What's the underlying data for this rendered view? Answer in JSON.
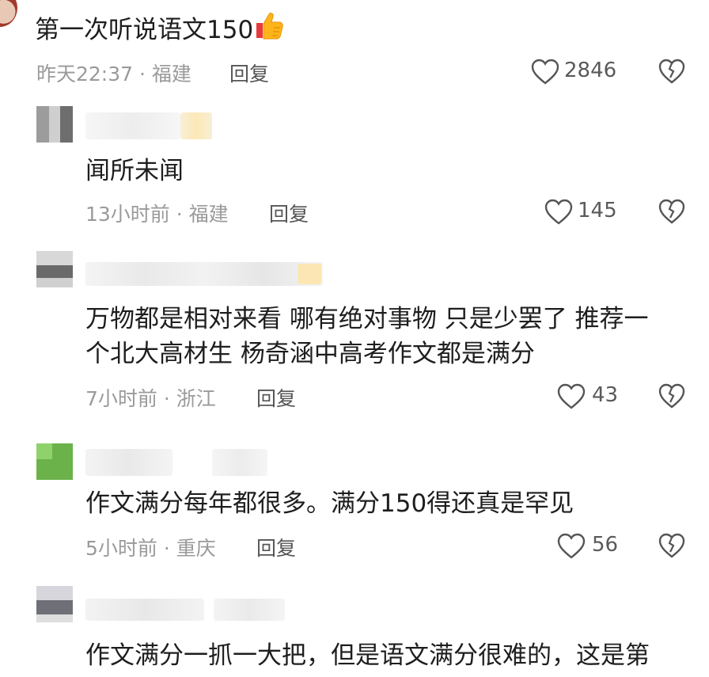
{
  "comments": [
    {
      "text": "第一次听说语文150",
      "time": "昨天22:37",
      "location": "福建",
      "reply_label": "回复",
      "likes": "2846",
      "icons": [
        "thumbs-up-emoji",
        "heart-icon",
        "dislike-heart-icon"
      ]
    },
    {
      "text": "闻所未闻",
      "time": "13小时前",
      "location": "福建",
      "reply_label": "回复",
      "likes": "145"
    },
    {
      "text_line1": "万物都是相对来看 哪有绝对事物 只是少罢了 推荐一",
      "text_line2": "个北大高材生 杨奇涵中高考作文都是满分",
      "time": "7小时前",
      "location": "浙江",
      "reply_label": "回复",
      "likes": "43"
    },
    {
      "text": "作文满分每年都很多。满分150得还真是罕见",
      "time": "5小时前",
      "location": "重庆",
      "reply_label": "回复",
      "likes": "56"
    },
    {
      "text": "作文满分一抓一大把，但是语文满分很难的，这是第"
    }
  ],
  "separator": "·",
  "colors": {
    "meta": "#9a9a9a",
    "text": "#1e1e1e",
    "icon": "#555555"
  }
}
